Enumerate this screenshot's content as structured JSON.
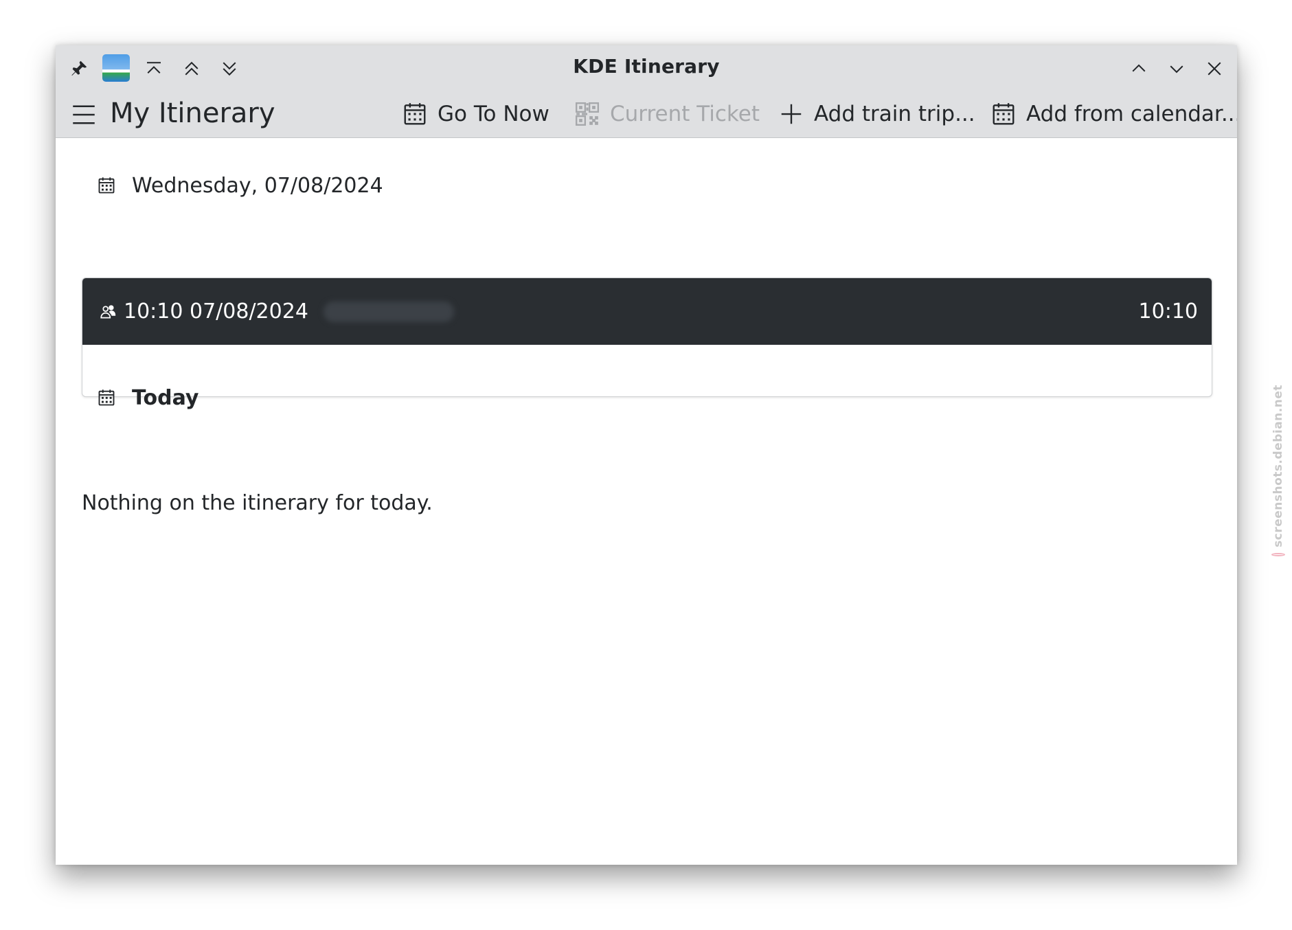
{
  "window": {
    "title": "KDE Itinerary"
  },
  "toolbar": {
    "page_title": "My Itinerary",
    "go_to_now": "Go To Now",
    "current_ticket": "Current Ticket",
    "add_train_trip": "Add train trip...",
    "add_from_calendar": "Add from calendar..."
  },
  "sections": [
    {
      "label": "Wednesday, 07/08/2024",
      "icon": "calendar-icon",
      "items": [
        {
          "icon": "people-icon",
          "start": "10:10 07/08/2024",
          "end": "10:10"
        }
      ]
    },
    {
      "label": "Today",
      "icon": "calendar-icon",
      "empty_text": "Nothing on the itinerary for today."
    }
  ],
  "watermark": "screenshots.debian.net",
  "colors": {
    "header_bg": "#dfe0e2",
    "card_header_bg": "#2a2e32",
    "text": "#232629",
    "disabled_text": "#a6a8ab"
  }
}
